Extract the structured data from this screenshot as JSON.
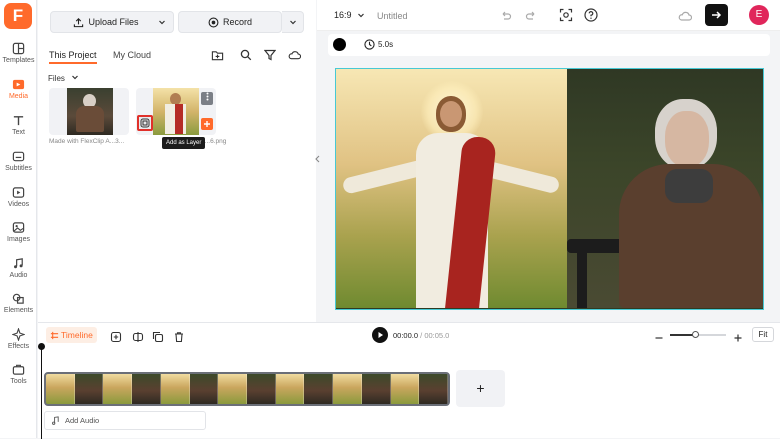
{
  "app": {
    "logo_letter": "F",
    "brand_color": "#ff6a2b"
  },
  "sidebar": {
    "items": [
      {
        "label": "Templates",
        "icon": "templates-icon"
      },
      {
        "label": "Media",
        "icon": "media-icon",
        "active": true
      },
      {
        "label": "Text",
        "icon": "text-icon"
      },
      {
        "label": "Subtitles",
        "icon": "subtitles-icon"
      },
      {
        "label": "Videos",
        "icon": "videos-icon"
      },
      {
        "label": "Images",
        "icon": "images-icon"
      },
      {
        "label": "Audio",
        "icon": "audio-icon"
      },
      {
        "label": "Elements",
        "icon": "elements-icon"
      },
      {
        "label": "Effects",
        "icon": "effects-icon"
      },
      {
        "label": "Tools",
        "icon": "tools-icon"
      }
    ]
  },
  "panel": {
    "upload_label": "Upload Files",
    "record_label": "Record",
    "tabs": [
      "This Project",
      "My Cloud"
    ],
    "files_label": "Files",
    "items": [
      {
        "caption": "Made with FlexClip A...3...",
        "kind": "woman"
      },
      {
        "caption": "...FlexClip A...6.png",
        "kind": "jesus"
      }
    ],
    "tooltip": "Add as Layer"
  },
  "topbar": {
    "ratio": "16:9",
    "title": "Untitled",
    "avatar": "E"
  },
  "subbar": {
    "duration": "5.0s",
    "color": "#000000"
  },
  "timeline": {
    "label": "Timeline",
    "time_current": "00:00.0",
    "time_separator": "/",
    "time_total": "00:05.0",
    "zoom": 0.45,
    "fit_label": "Fit",
    "add_audio_label": "Add Audio",
    "add_clip_symbol": "+"
  }
}
